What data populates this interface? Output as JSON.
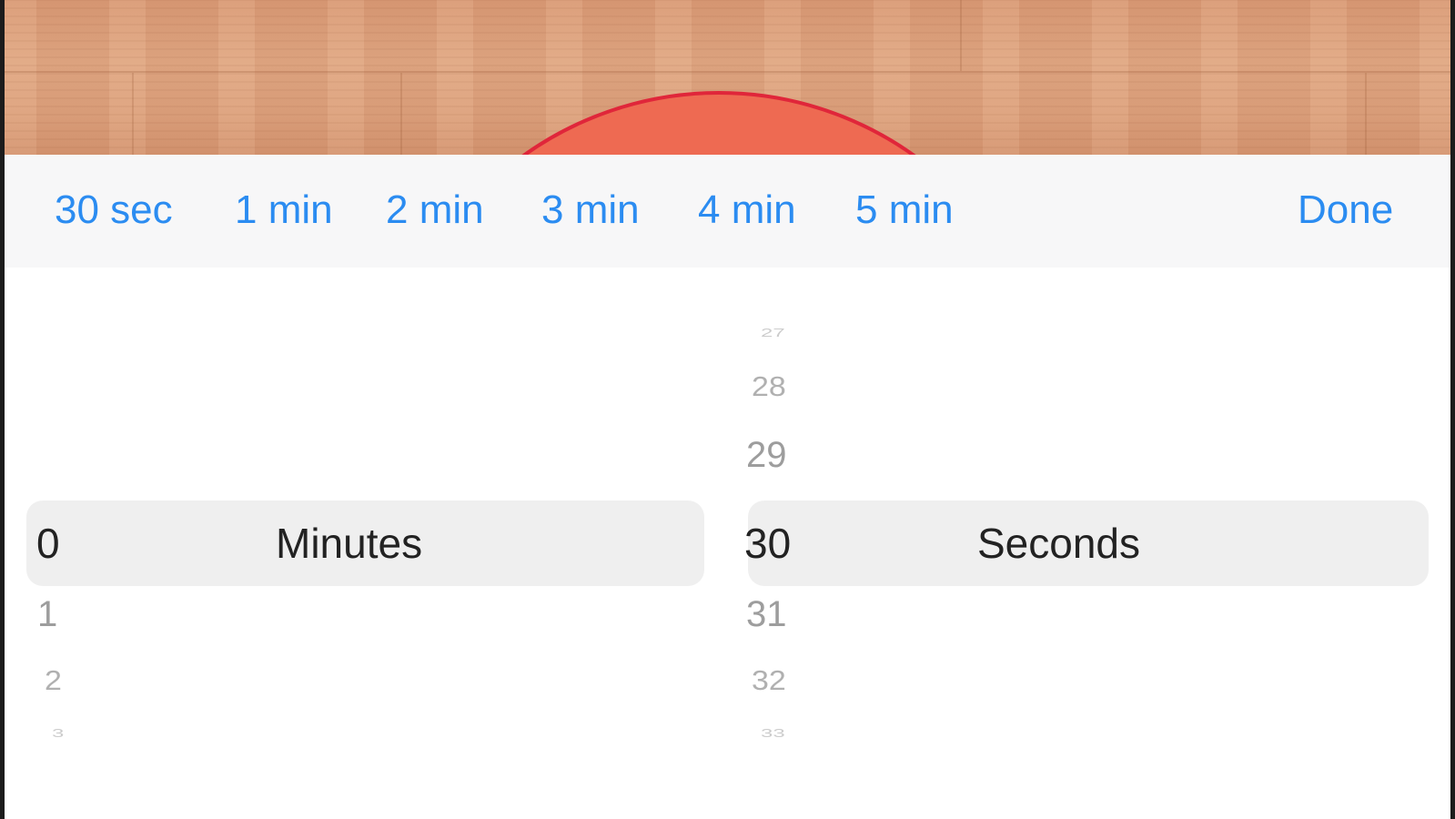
{
  "toolbar": {
    "presets": [
      "30 sec",
      "1 min",
      "2 min",
      "3 min",
      "4 min",
      "5 min"
    ],
    "done_label": "Done"
  },
  "picker": {
    "minutes": {
      "selected": "0",
      "unit": "Minutes",
      "below": [
        "1",
        "2",
        "3"
      ]
    },
    "seconds": {
      "above": [
        "27",
        "28",
        "29"
      ],
      "selected": "30",
      "unit": "Seconds",
      "below": [
        "31",
        "32",
        "33"
      ]
    }
  },
  "colors": {
    "accent": "#2b8cf1",
    "dial_fill": "#ee6a52",
    "dial_border": "#e0263a",
    "selection_band": "#efefef"
  }
}
